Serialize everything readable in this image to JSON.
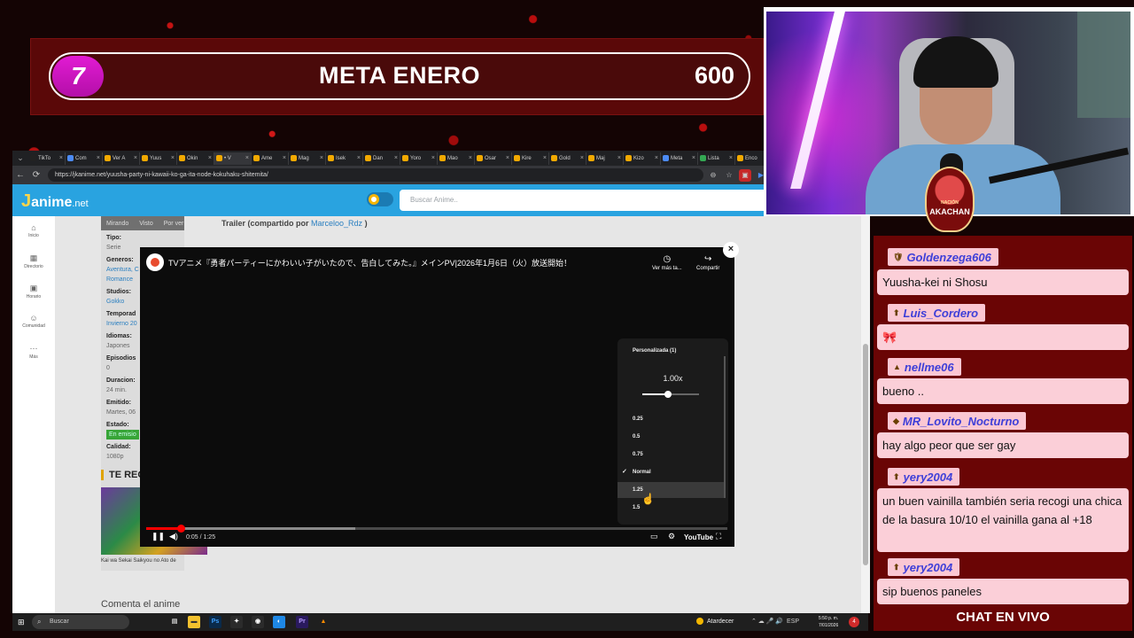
{
  "goal": {
    "level": "7",
    "title": "META ENERO",
    "value": "600"
  },
  "browser": {
    "tabs": [
      "TikTo",
      "Com",
      "Ver A",
      "Yuus",
      "Okin",
      "• V",
      "Ame",
      "Mag",
      "Isek",
      "Dan",
      "Yoro",
      "Mao",
      "Osar",
      "Kire",
      "Gold",
      "Maj",
      "Kizo",
      "Meta",
      "Lista",
      "Enco"
    ],
    "url": "https://jkanime.net/yuusha-party-ni-kawaii-ko-ga-ita-node-kokuhaku-shitemita/"
  },
  "site": {
    "logo_k": "J",
    "logo_text": "anime",
    "logo_tld": ".net",
    "search_placeholder": "Buscar Anime..",
    "sidenav": [
      {
        "icon": "⌂",
        "label": "Inicio"
      },
      {
        "icon": "▦",
        "label": "Directorio"
      },
      {
        "icon": "▣",
        "label": "Horario"
      },
      {
        "icon": "☺",
        "label": "Comunidad"
      },
      {
        "icon": "⋯",
        "label": "Más"
      }
    ],
    "info_tabs": [
      "Mirando",
      "Visto",
      "Por ver"
    ],
    "info": {
      "tipo_label": "Tipo:",
      "tipo": "Serie",
      "generos_label": "Generos:",
      "generos_1": "Aventura, C",
      "generos_2": "Romance",
      "studios_label": "Studios:",
      "studios": "Gokko",
      "temporada_label": "Temporad",
      "temporada": "Invierno 20",
      "idiomas_label": "Idiomas:",
      "idiomas": "Japones",
      "episodios_label": "Episodios",
      "episodios": "0",
      "duracion_label": "Duracion:",
      "duracion": "24 min.",
      "emitido_label": "Emitido:",
      "emitido": "Martes, 06",
      "estado_label": "Estado:",
      "estado": "En emisio",
      "calidad_label": "Calidad:",
      "calidad": "1080p"
    },
    "trailer_title": "Trailer (compartido por ",
    "trailer_user": "Marceloo_Rdz",
    "trailer_close": " )",
    "te_rec": "TE REC",
    "rec_label": "Kai wa Sekai Saikyou no Ato de",
    "comenta": "Comenta el anime"
  },
  "video": {
    "title": "TVアニメ『勇者パーティーにかわいい子がいたので、告白してみた。』メインPV|2026年1月6日（火）放送開始！",
    "watch_later": "Ver más ta...",
    "share": "Compartir",
    "time": "0:05 / 1:25",
    "progress_fraction": 0.06,
    "buffer_fraction": 0.36,
    "youtube": "YouTube",
    "speed_menu": {
      "custom_label": "Personalizada (1)",
      "current": "1.00x",
      "slider_fraction": 0.45,
      "options": [
        "0.25",
        "0.5",
        "0.75",
        "Normal",
        "1.25",
        "1.5"
      ],
      "selected": "Normal",
      "hovered": "1.25"
    }
  },
  "taskbar": {
    "search": "Buscar",
    "weather": "Atardecer",
    "lang": "ESP",
    "time": "5:50 p. m.",
    "date": "7/01/2026",
    "notif_count": "4"
  },
  "stream_badge": {
    "top": "NACIÓN",
    "name": "AKACHAN"
  },
  "chat": {
    "messages": [
      {
        "user": "Goldenzega606",
        "icon": "🛡",
        "text": "Yuusha-kei ni Shosu"
      },
      {
        "user": "Luis_Cordero",
        "icon": "⬆",
        "text": "🎀"
      },
      {
        "user": "nellme06",
        "icon": "▲",
        "text": "bueno .."
      },
      {
        "user": "MR_Lovito_Nocturno",
        "icon": "◆",
        "text": "hay algo peor que ser gay"
      },
      {
        "user": "yery2004",
        "icon": "⬆",
        "text": "un buen vainilla también seria recogi una chica de la basura 10/10 el vainilla gana al +18"
      },
      {
        "user": "yery2004",
        "icon": "⬆",
        "text": "sip buenos paneles"
      }
    ],
    "footer": "CHAT EN VIVO"
  }
}
